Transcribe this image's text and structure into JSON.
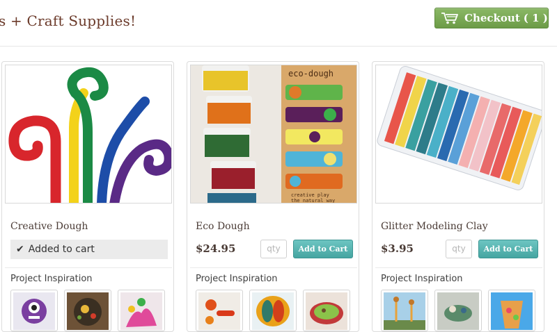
{
  "header": {
    "title": "s + Craft Supplies!",
    "checkout_label": "Checkout",
    "checkout_count": "( 1 )"
  },
  "products": [
    {
      "name": "Creative Dough",
      "status": "Added to cart",
      "inspiration_label": "Project Inspiration",
      "thumbs": 3
    },
    {
      "name": "Eco Dough",
      "price": "$24.95",
      "qty_placeholder": "qty",
      "add_label": "Add to Cart",
      "inspiration_label": "Project Inspiration",
      "box_title": "eco-dough",
      "box_tagline_1": "creative play",
      "box_tagline_2": "the natural way",
      "thumbs": 3
    },
    {
      "name": "Glitter Modeling Clay",
      "price": "$3.95",
      "qty_placeholder": "qty",
      "add_label": "Add to Cart",
      "inspiration_label": "Project Inspiration",
      "thumbs": 3
    }
  ],
  "icons": {
    "cart": "shopping-cart-icon",
    "check": "checkmark-icon"
  },
  "colors": {
    "checkout_green": "#6c9b47",
    "add_to_cart_teal": "#45a5a1",
    "title_brown": "#6b3a2a"
  }
}
